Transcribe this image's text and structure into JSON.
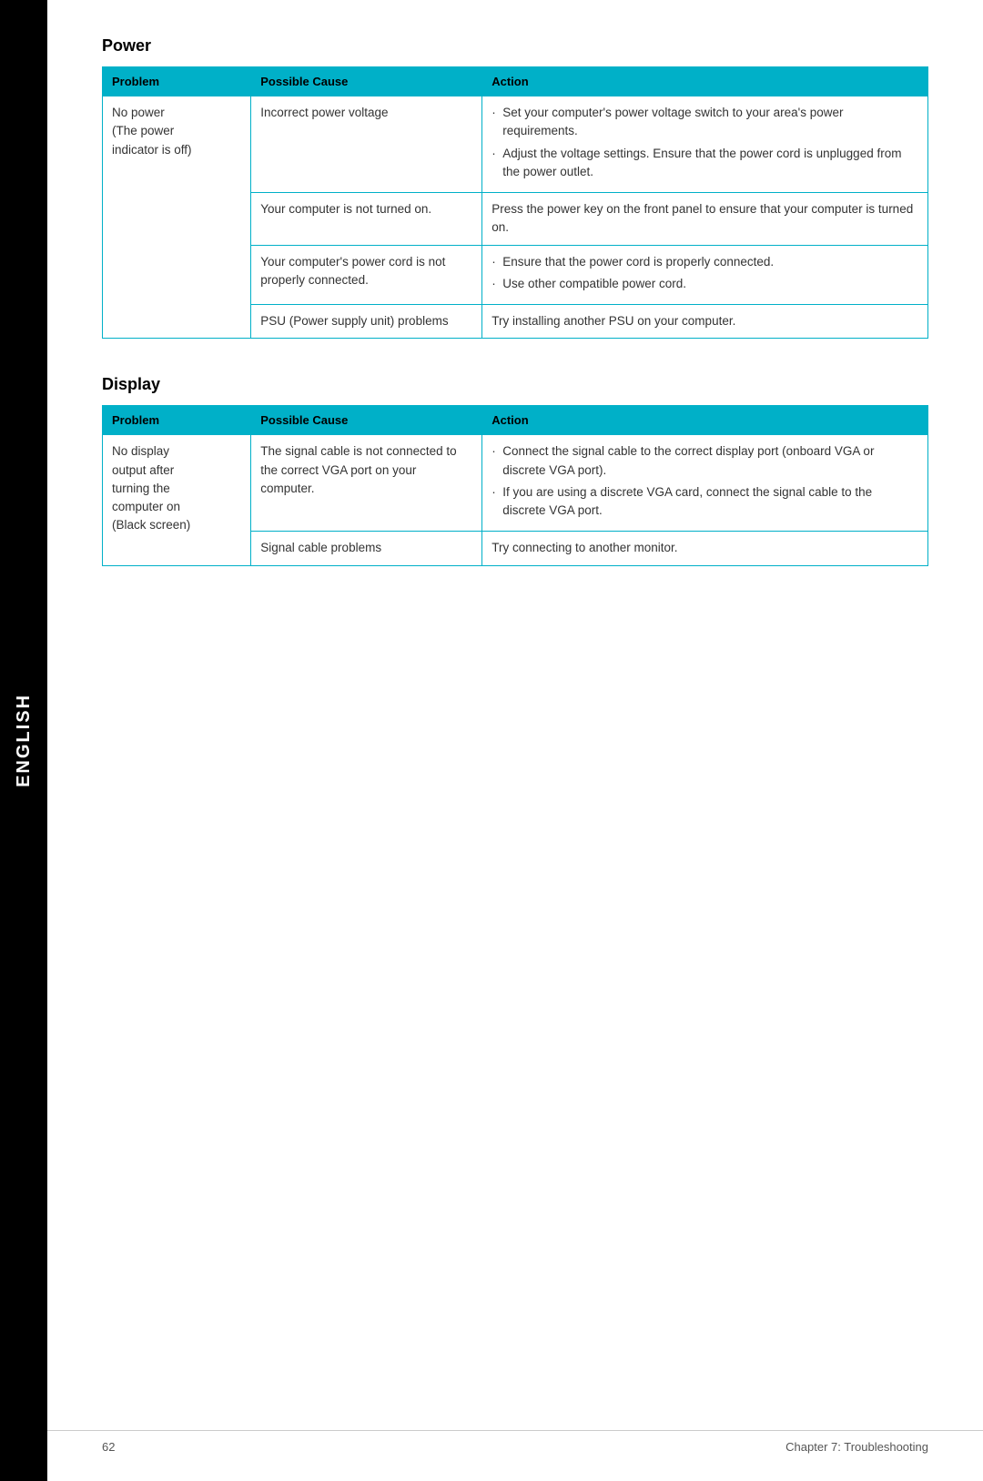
{
  "sidebar": {
    "label": "ENGLISH"
  },
  "page": {
    "footer_left": "62",
    "footer_right": "Chapter 7: Troubleshooting"
  },
  "power_section": {
    "title": "Power",
    "table": {
      "headers": [
        "Problem",
        "Possible Cause",
        "Action"
      ],
      "rows": [
        {
          "problem": "No power\n(The power\nindicator is off)",
          "cause": "Incorrect power voltage",
          "action_bullets": [
            "Set your computer's power voltage switch to your area's power requirements.",
            "Adjust the voltage settings. Ensure that the power cord is unplugged from the power outlet."
          ],
          "action_plain": null,
          "rowspan": 4
        },
        {
          "problem": null,
          "cause": "Your computer is not turned on.",
          "action_bullets": null,
          "action_plain": "Press the power key on the front panel to ensure that your computer is turned on."
        },
        {
          "problem": null,
          "cause": "Your computer's power cord is not properly connected.",
          "action_bullets": [
            "Ensure that the power cord is properly connected.",
            "Use other compatible power cord."
          ],
          "action_plain": null
        },
        {
          "problem": null,
          "cause": "PSU (Power supply unit) problems",
          "action_bullets": null,
          "action_plain": "Try installing another PSU on your computer."
        }
      ]
    }
  },
  "display_section": {
    "title": "Display",
    "table": {
      "headers": [
        "Problem",
        "Possible Cause",
        "Action"
      ],
      "rows": [
        {
          "problem": "No display\noutput after\nturning the\ncomputer on\n(Black screen)",
          "cause": "The signal cable is not connected to the correct VGA port on your computer.",
          "action_bullets": [
            "Connect the signal cable to the correct display port (onboard VGA or discrete VGA port).",
            "If you are using a discrete VGA card, connect the signal cable to the discrete VGA port."
          ],
          "action_plain": null,
          "rowspan": 2
        },
        {
          "problem": null,
          "cause": "Signal cable problems",
          "action_bullets": null,
          "action_plain": "Try connecting to another monitor."
        }
      ]
    }
  }
}
